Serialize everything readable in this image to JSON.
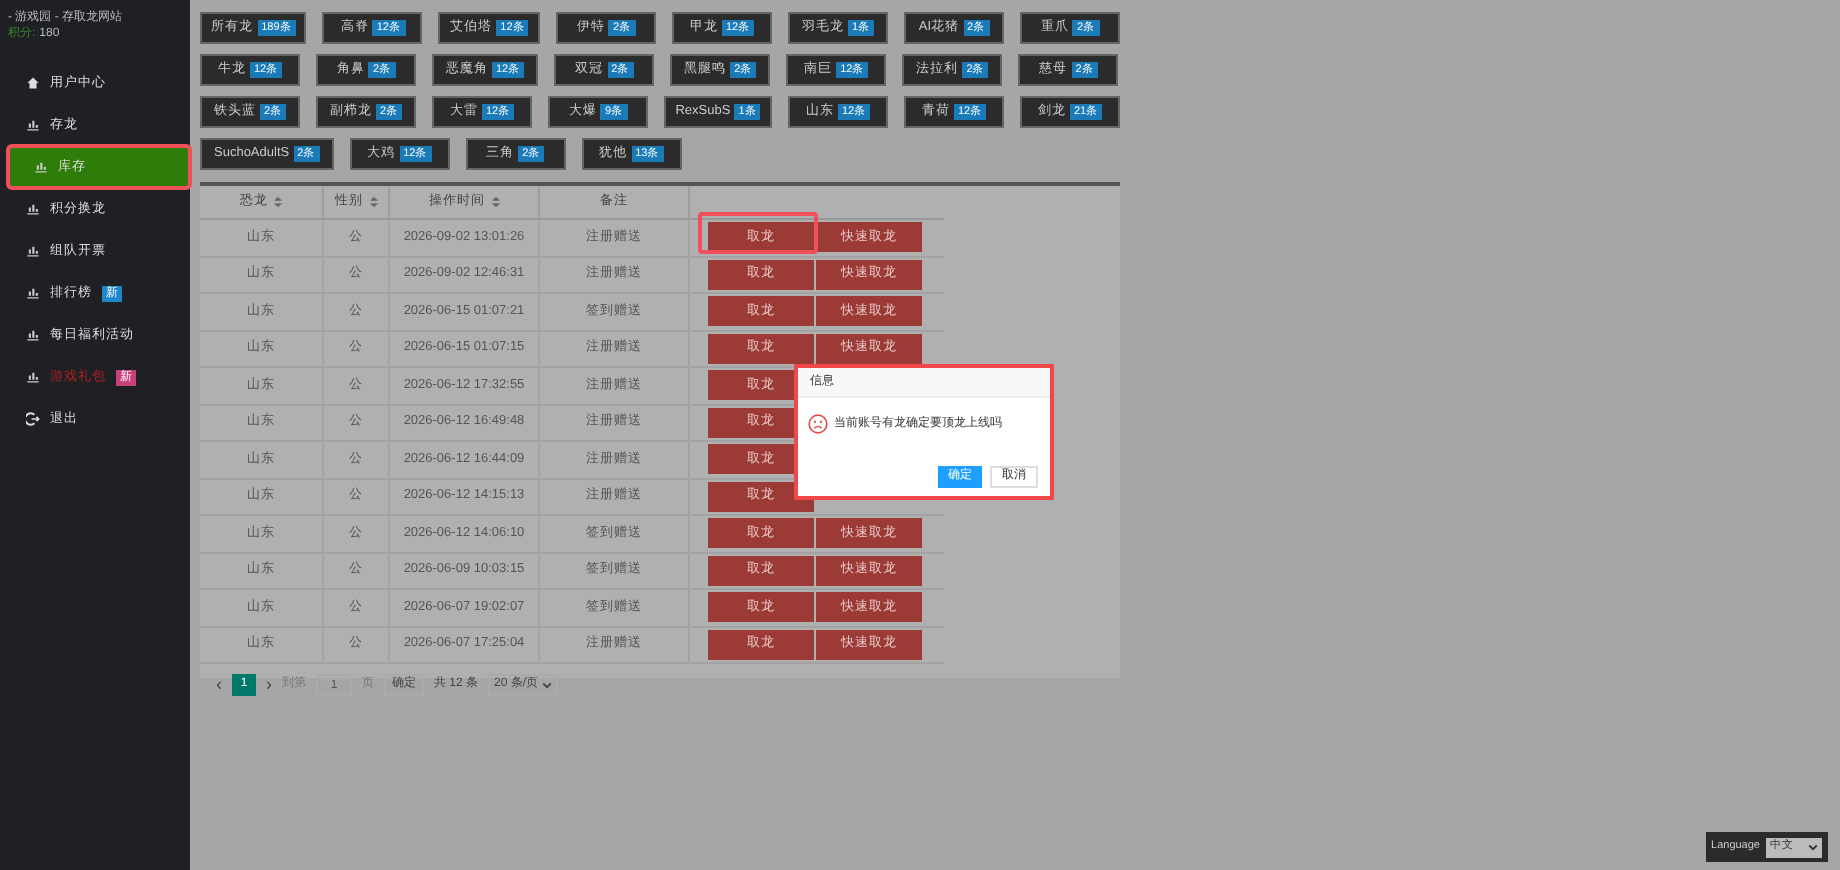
{
  "sidebar": {
    "site_title": "- 游戏园 - 存取龙网站",
    "points_label": "积分:",
    "points_value": "180",
    "items": [
      {
        "label": "用户中心",
        "kind": "home",
        "selected": false,
        "highlighted": false,
        "alert": false
      },
      {
        "label": "存龙",
        "kind": "bars",
        "selected": false,
        "highlighted": false,
        "alert": false
      },
      {
        "label": "库存",
        "kind": "bars",
        "selected": true,
        "highlighted": true,
        "alert": false
      },
      {
        "label": "积分换龙",
        "kind": "bars",
        "selected": false,
        "highlighted": false,
        "alert": false
      },
      {
        "label": "组队开票",
        "kind": "bars",
        "selected": false,
        "highlighted": false,
        "alert": false
      },
      {
        "label": "排行榜",
        "kind": "bars",
        "selected": false,
        "highlighted": false,
        "alert": false,
        "badge": {
          "text": "新",
          "color": "#1e88c8"
        }
      },
      {
        "label": "每日福利活动",
        "kind": "bars",
        "selected": false,
        "highlighted": false,
        "alert": false
      },
      {
        "label": "游戏礼包",
        "kind": "bars",
        "selected": false,
        "highlighted": false,
        "alert": true,
        "badge": {
          "text": "新",
          "color": "#c8407a"
        }
      },
      {
        "label": "退出",
        "kind": "logout",
        "selected": false,
        "highlighted": false,
        "alert": false
      }
    ]
  },
  "filters": [
    {
      "label": "所有龙",
      "count": "189条"
    },
    {
      "label": "高脊",
      "count": "12条"
    },
    {
      "label": "艾伯塔",
      "count": "12条"
    },
    {
      "label": "伊特",
      "count": "2条"
    },
    {
      "label": "甲龙",
      "count": "12条"
    },
    {
      "label": "羽毛龙",
      "count": "1条"
    },
    {
      "label": "AI花猪",
      "count": "2条"
    },
    {
      "label": "重爪",
      "count": "2条"
    },
    {
      "label": "牛龙",
      "count": "12条"
    },
    {
      "label": "角鼻",
      "count": "2条"
    },
    {
      "label": "恶魔角",
      "count": "12条"
    },
    {
      "label": "双冠",
      "count": "2条"
    },
    {
      "label": "黑腿鸣",
      "count": "2条"
    },
    {
      "label": "南巨",
      "count": "12条"
    },
    {
      "label": "法拉利",
      "count": "2条"
    },
    {
      "label": "慈母",
      "count": "2条"
    },
    {
      "label": "铁头蓝",
      "count": "2条"
    },
    {
      "label": "副栉龙",
      "count": "2条"
    },
    {
      "label": "大雷",
      "count": "12条"
    },
    {
      "label": "大爆",
      "count": "9条"
    },
    {
      "label": "RexSubS",
      "count": "1条"
    },
    {
      "label": "山东",
      "count": "12条"
    },
    {
      "label": "青荷",
      "count": "12条"
    },
    {
      "label": "剑龙",
      "count": "21条"
    },
    {
      "label": "SuchoAdultS",
      "count": "2条"
    },
    {
      "label": "大鸡",
      "count": "12条"
    },
    {
      "label": "三角",
      "count": "2条"
    },
    {
      "label": "犹他",
      "count": "13条"
    }
  ],
  "table": {
    "columns": [
      {
        "label": "恐龙",
        "sortable": true
      },
      {
        "label": "性别",
        "sortable": true
      },
      {
        "label": "操作时间",
        "sortable": true
      },
      {
        "label": "备注",
        "sortable": false
      }
    ],
    "rows": [
      {
        "cells": [
          "山东",
          "公",
          "2026-09-02 13:01:26",
          "注册赠送"
        ],
        "buttons": [
          "取龙",
          "快速取龙"
        ],
        "highlighted": true
      },
      {
        "cells": [
          "山东",
          "公",
          "2026-09-02 12:46:31",
          "注册赠送"
        ],
        "buttons": [
          "取龙",
          "快速取龙"
        ],
        "highlighted": false
      },
      {
        "cells": [
          "山东",
          "公",
          "2026-06-15 01:07:21",
          "签到赠送"
        ],
        "buttons": [
          "取龙",
          "快速取龙"
        ],
        "highlighted": false
      },
      {
        "cells": [
          "山东",
          "公",
          "2026-06-15 01:07:15",
          "注册赠送"
        ],
        "buttons": [
          "取龙",
          "快速取龙"
        ],
        "highlighted": false
      },
      {
        "cells": [
          "山东",
          "公",
          "2026-06-12 17:32:55",
          "注册赠送"
        ],
        "buttons": [
          "取龙"
        ],
        "highlighted": false
      },
      {
        "cells": [
          "山东",
          "公",
          "2026-06-12 16:49:48",
          "注册赠送"
        ],
        "buttons": [
          "取龙"
        ],
        "highlighted": false
      },
      {
        "cells": [
          "山东",
          "公",
          "2026-06-12 16:44:09",
          "注册赠送"
        ],
        "buttons": [
          "取龙"
        ],
        "highlighted": false
      },
      {
        "cells": [
          "山东",
          "公",
          "2026-06-12 14:15:13",
          "注册赠送"
        ],
        "buttons": [
          "取龙"
        ],
        "highlighted": false
      },
      {
        "cells": [
          "山东",
          "公",
          "2026-06-12 14:06:10",
          "签到赠送"
        ],
        "buttons": [
          "取龙",
          "快速取龙"
        ],
        "highlighted": false
      },
      {
        "cells": [
          "山东",
          "公",
          "2026-06-09 10:03:15",
          "签到赠送"
        ],
        "buttons": [
          "取龙",
          "快速取龙"
        ],
        "highlighted": false
      },
      {
        "cells": [
          "山东",
          "公",
          "2026-06-07 19:02:07",
          "签到赠送"
        ],
        "buttons": [
          "取龙",
          "快速取龙"
        ],
        "highlighted": false
      },
      {
        "cells": [
          "山东",
          "公",
          "2026-06-07 17:25:04",
          "注册赠送"
        ],
        "buttons": [
          "取龙",
          "快速取龙"
        ],
        "highlighted": false
      }
    ]
  },
  "pagination": {
    "prev": "‹",
    "pages": [
      {
        "label": "1",
        "selected": true
      }
    ],
    "next": "›",
    "goto_label": "到第",
    "page_value": "1",
    "page_unit": "页",
    "confirm": "确定",
    "total": "共 12 条",
    "page_size": "20 条/页"
  },
  "dialog": {
    "title": "信息",
    "message": "当前账号有龙确定要顶龙上线吗",
    "highlighted": true,
    "buttons": [
      {
        "label": "确定",
        "kind": "primary"
      },
      {
        "label": "取消",
        "kind": "default"
      }
    ]
  },
  "language": {
    "label": "Language",
    "value": "中文"
  }
}
